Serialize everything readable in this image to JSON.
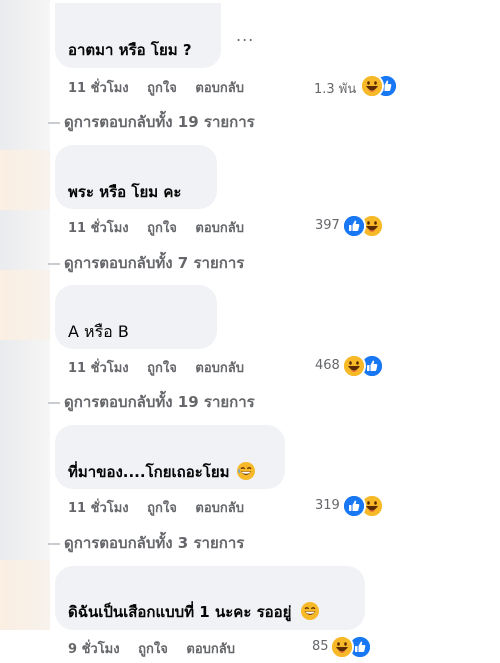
{
  "comments": [
    {
      "text": "อาตมา หรือ โยม ?",
      "more": "...",
      "time": "11 ชั่วโมง",
      "like": "ถูกใจ",
      "reply": "ตอบกลับ",
      "reaction_count": "1.3 พัน",
      "reaction_icons": [
        "laugh-icon",
        "like-icon"
      ],
      "replies_link": "ดูการตอบกลับทั้ง 19 รายการ"
    },
    {
      "text": "พระ หรือ โยม คะ",
      "time": "11 ชั่วโมง",
      "like": "ถูกใจ",
      "reply": "ตอบกลับ",
      "reaction_count": "397",
      "reaction_icons": [
        "like-icon",
        "laugh-icon"
      ],
      "replies_link": "ดูการตอบกลับทั้ง 7 รายการ"
    },
    {
      "text": "A หรือ B",
      "time": "11 ชั่วโมง",
      "like": "ถูกใจ",
      "reply": "ตอบกลับ",
      "reaction_count": "468",
      "reaction_icons": [
        "laugh-icon",
        "like-icon"
      ],
      "replies_link": "ดูการตอบกลับทั้ง 19 รายการ"
    },
    {
      "text": "ที่มาของ....โกยเถอะโยม",
      "time": "11 ชั่วโมง",
      "like": "ถูกใจ",
      "reply": "ตอบกลับ",
      "reaction_count": "319",
      "reaction_icons": [
        "like-icon",
        "laugh-icon"
      ],
      "replies_link": "ดูการตอบกลับทั้ง 3 รายการ"
    },
    {
      "text": "ดิฉันเป็นเสือกแบบที่ 1 นะคะ รออยู่",
      "time": "9 ชั่วโมง",
      "like": "ถูกใจ",
      "reply": "ตอบกลับ",
      "reaction_count": "85",
      "reaction_icons": [
        "laugh-icon",
        "like-icon"
      ]
    }
  ],
  "colors": {
    "bubble": "#f0f2f5",
    "meta_text": "#65676b",
    "like_blue": "#1877f2",
    "laugh_yellow": "#f7b928"
  }
}
